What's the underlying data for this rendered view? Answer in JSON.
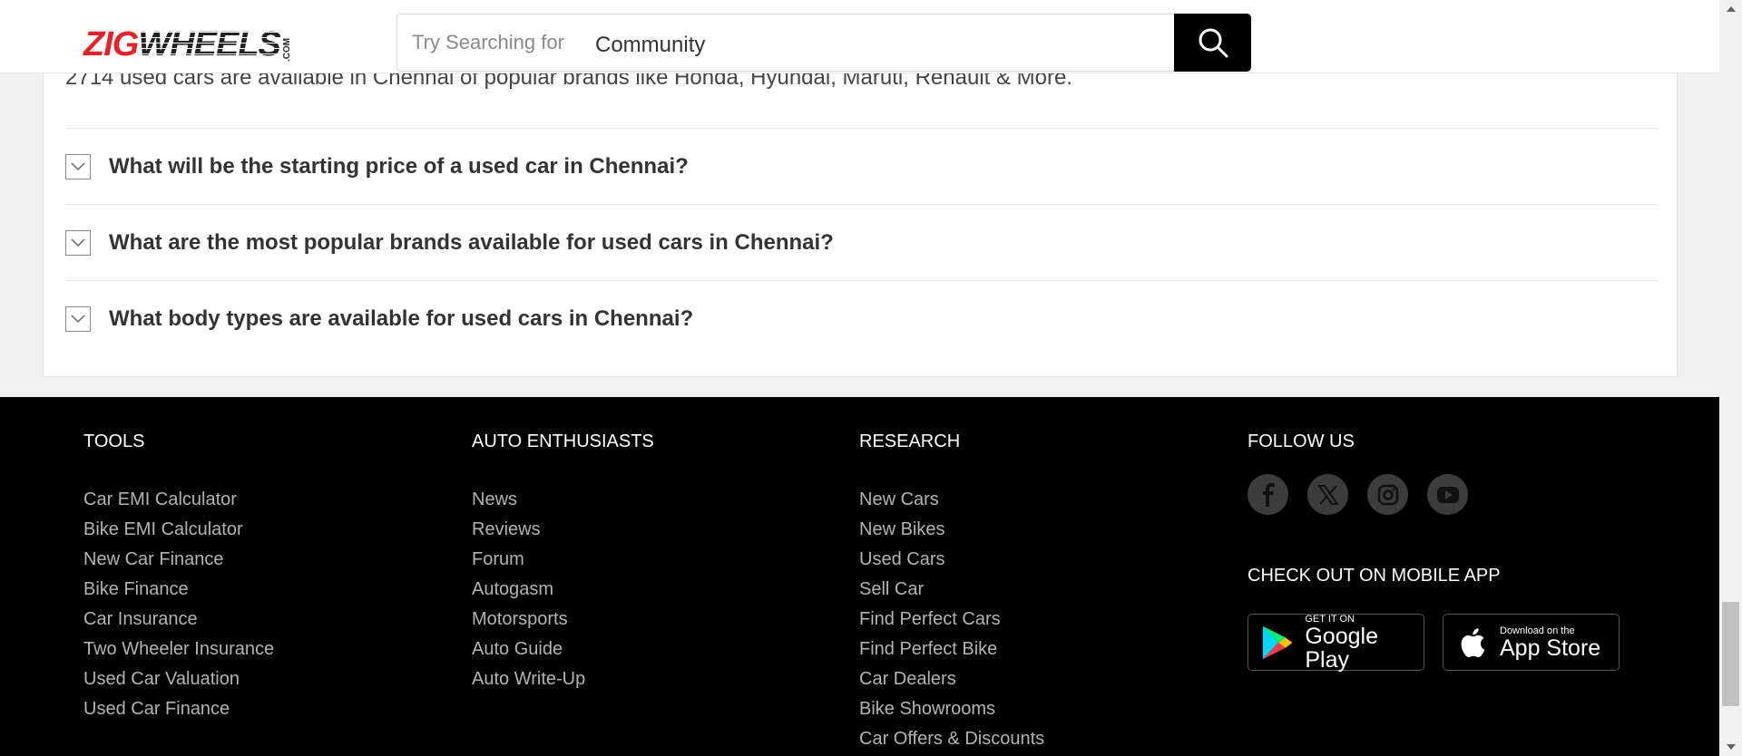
{
  "header": {
    "logo": {
      "zig": "ZIG",
      "wheels": "WHEELS",
      "com": ".COM"
    },
    "search": {
      "placeholder": "Try Searching for",
      "value": "Community"
    }
  },
  "faq": {
    "intro": "2714 used cars are available in Chennai of popular brands like Honda, Hyundai, Maruti, Renault & More.",
    "questions": [
      "What will be the starting price of a used car in Chennai?",
      "What are the most popular brands available for used cars in Chennai?",
      "What body types are available for used cars in Chennai?"
    ]
  },
  "footer": {
    "tools": {
      "title": "TOOLS",
      "links": [
        "Car EMI Calculator",
        "Bike EMI Calculator",
        "New Car Finance",
        "Bike Finance",
        "Car Insurance",
        "Two Wheeler Insurance",
        "Used Car Valuation",
        "Used Car Finance"
      ]
    },
    "enthusiasts": {
      "title": "AUTO ENTHUSIASTS",
      "links": [
        "News",
        "Reviews",
        "Forum",
        "Autogasm",
        "Motorsports",
        "Auto Guide",
        "Auto Write-Up"
      ]
    },
    "research": {
      "title": "RESEARCH",
      "links": [
        "New Cars",
        "New Bikes",
        "Used Cars",
        "Sell Car",
        "Find Perfect Cars",
        "Find Perfect Bike",
        "Car Dealers",
        "Bike Showrooms",
        "Car Offers & Discounts"
      ]
    },
    "follow": {
      "title": "FOLLOW US",
      "icons": [
        "facebook-icon",
        "x-twitter-icon",
        "instagram-icon",
        "youtube-icon"
      ]
    },
    "mobile": {
      "title": "CHECK OUT ON MOBILE APP",
      "google_small": "GET IT ON",
      "google_big": "Google Play",
      "apple_small": "Download on the",
      "apple_big": "App Store"
    }
  },
  "colors": {
    "brand_red": "#e8222b",
    "footer_bg": "#000000",
    "link_gray": "#b3b3b3"
  }
}
